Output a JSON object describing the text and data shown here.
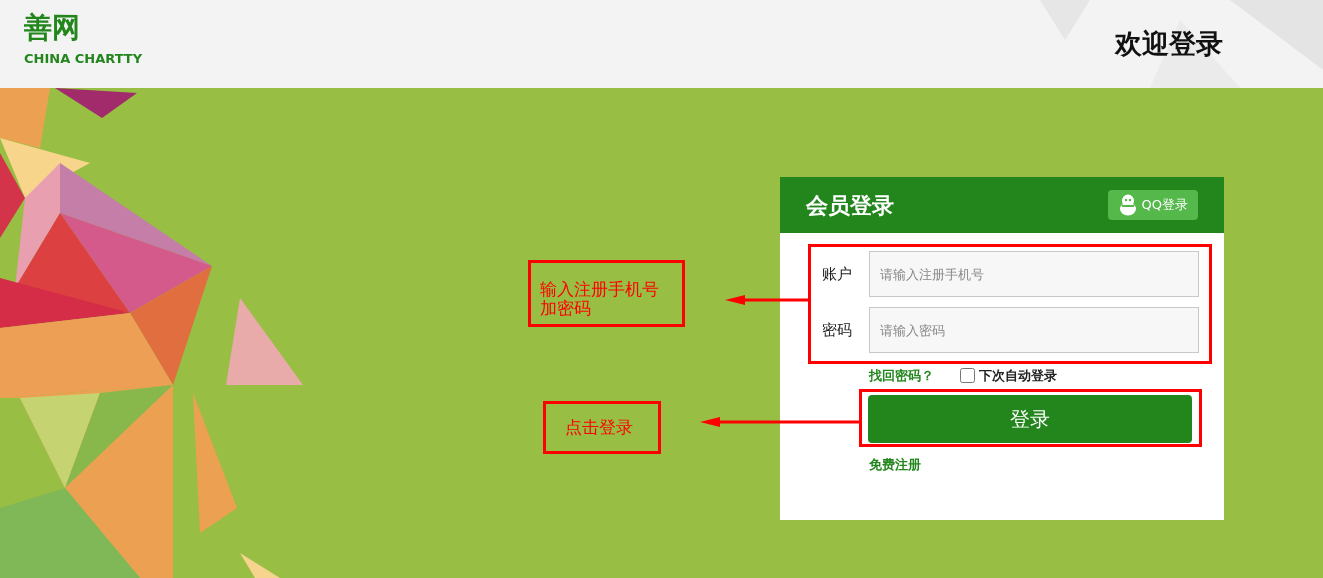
{
  "header": {
    "logo": "善网",
    "tagline": "CHINA CHARTTY",
    "title": "欢迎登录"
  },
  "login": {
    "title": "会员登录",
    "qq_button": "QQ登录",
    "fields": [
      {
        "label": "账户",
        "placeholder": "请输入注册手机号"
      },
      {
        "label": "密码",
        "placeholder": "请输入密码"
      }
    ],
    "forgot_link": "找回密码？",
    "remember": {
      "label": "下次自动登录",
      "checked": false
    },
    "submit": "登录",
    "register_link": "免费注册"
  },
  "annotations": [
    {
      "text": "输入注册手机号加密码"
    },
    {
      "text": "点击登录"
    }
  ]
}
